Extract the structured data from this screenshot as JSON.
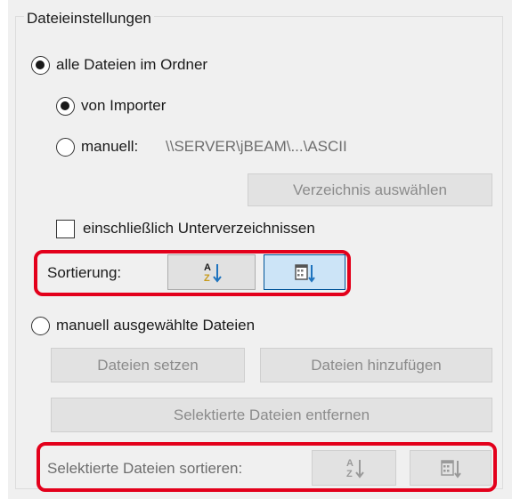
{
  "group": {
    "title": "Dateieinstellungen"
  },
  "options": {
    "all_files": {
      "label": "alle Dateien im Ordner",
      "selected": true
    },
    "from_importer": {
      "label": "von Importer",
      "selected": true
    },
    "manual_path": {
      "label": "manuell:",
      "path": "\\\\SERVER\\jBEAM\\...\\ASCII",
      "selected": false
    },
    "choose_dir_button": "Verzeichnis auswählen",
    "include_subdirs": {
      "label": "einschließlich Unterverzeichnissen",
      "checked": false
    },
    "sorting": {
      "label": "Sortierung:",
      "az_icon": "sort-az-icon",
      "date_icon": "sort-date-icon",
      "active": "date"
    },
    "manual_files": {
      "label": "manuell ausgewählte Dateien",
      "selected": false
    },
    "set_files_button": "Dateien setzen",
    "add_files_button": "Dateien hinzufügen",
    "remove_selected_button": "Selektierte Dateien entfernen",
    "sort_selected": {
      "label": "Selektierte Dateien sortieren:",
      "az_icon": "sort-az-icon",
      "date_icon": "sort-date-icon"
    }
  },
  "colors": {
    "highlight": "#e3001b",
    "pressed_bg": "#cce4f7",
    "pressed_border": "#005499",
    "sort_arrow": "#1e73be"
  }
}
